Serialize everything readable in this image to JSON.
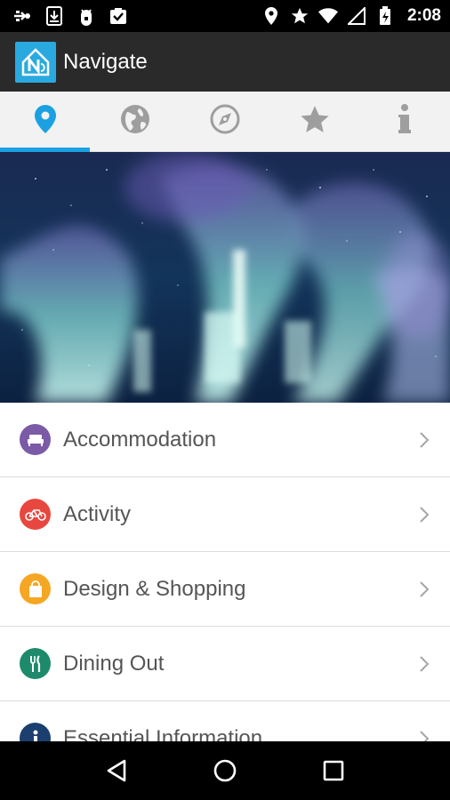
{
  "status_bar": {
    "time": "2:08",
    "left_icons": [
      "usb-icon",
      "download-icon",
      "android-debug-icon",
      "clipboard-icon"
    ],
    "right_icons": [
      "location-icon",
      "star-icon",
      "wifi-icon",
      "signal-icon",
      "battery-icon"
    ]
  },
  "app_bar": {
    "title": "Navigate",
    "logo_icon": "navigate-logo-icon"
  },
  "tabs": [
    {
      "name": "location",
      "icon": "location-pin-icon",
      "active": true
    },
    {
      "name": "globe",
      "icon": "globe-icon",
      "active": false
    },
    {
      "name": "compass",
      "icon": "compass-icon",
      "active": false
    },
    {
      "name": "favorites",
      "icon": "star-icon",
      "active": false
    },
    {
      "name": "info",
      "icon": "info-icon",
      "active": false
    }
  ],
  "colors": {
    "accent": "#1ba1e2",
    "app_bar": "#2a2a2a",
    "tab_bar": "#f2f2f2"
  },
  "categories": [
    {
      "label": "Accommodation",
      "icon": "bed-icon",
      "color": "#7b5aa6"
    },
    {
      "label": "Activity",
      "icon": "bicycle-icon",
      "color": "#e8473f"
    },
    {
      "label": "Design & Shopping",
      "icon": "shopping-bag-icon",
      "color": "#f5a623"
    },
    {
      "label": "Dining Out",
      "icon": "fork-knife-icon",
      "color": "#1d8a6b"
    },
    {
      "label": "Essential Information",
      "icon": "info-icon",
      "color": "#1b3f6e"
    }
  ]
}
